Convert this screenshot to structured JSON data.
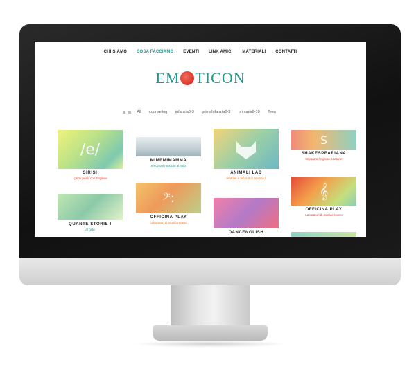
{
  "nav": {
    "items": [
      "CHI SIAMO",
      "COSA FACCIAMO",
      "EVENTI",
      "LINK AMICI",
      "MATERIALI",
      "CONTATTI"
    ]
  },
  "logo": {
    "left": "EM",
    "right": "TICON",
    "middle": "E"
  },
  "filters": {
    "items": [
      "All",
      "counseling",
      "infanzia0-3",
      "primaInfanzia0-3",
      "primaria6-10",
      "Teen"
    ]
  },
  "cards": [
    {
      "title": "SIRISI",
      "subtitle": "i primi passi con l'inglese",
      "sub_color": "#e23a2a",
      "icon": "/e/"
    },
    {
      "title": "MIMEMIMAMMA",
      "subtitle": "emozioni musicali al nido",
      "sub_color": "#1f9a8f",
      "icon": ""
    },
    {
      "title": "ANIMALI LAB",
      "subtitle": "teatrale e laboratori animati t",
      "sub_color": "#f07a2a",
      "icon": "fox"
    },
    {
      "title": "SHAKESPEARIANA",
      "subtitle": "Imparare l'inglese a teatro!",
      "sub_color": "#e23a2a",
      "icon": "S"
    },
    {
      "title": "QUANTE STORIE !",
      "subtitle": "al nido",
      "sub_color": "#1f9a8f",
      "icon": ""
    },
    {
      "title": "OFFICINA PLAY",
      "subtitle": "Laboratori di musica teatro",
      "sub_color": "#f07a2a",
      "icon": "𝄢:"
    },
    {
      "title": "DANCENGLISH",
      "subtitle": "",
      "sub_color": "#e23a2a",
      "icon": ""
    },
    {
      "title": "OFFICINA PLAY",
      "subtitle": "Laboratori di musica-teatro",
      "sub_color": "#e23a2a",
      "icon": "𝄞"
    },
    {
      "title": "",
      "subtitle": "",
      "sub_color": "#1f9a8f",
      "icon": ""
    }
  ],
  "colors": {
    "accent": "#1f9a8f",
    "red": "#e23a2a",
    "orange": "#f07a2a"
  }
}
